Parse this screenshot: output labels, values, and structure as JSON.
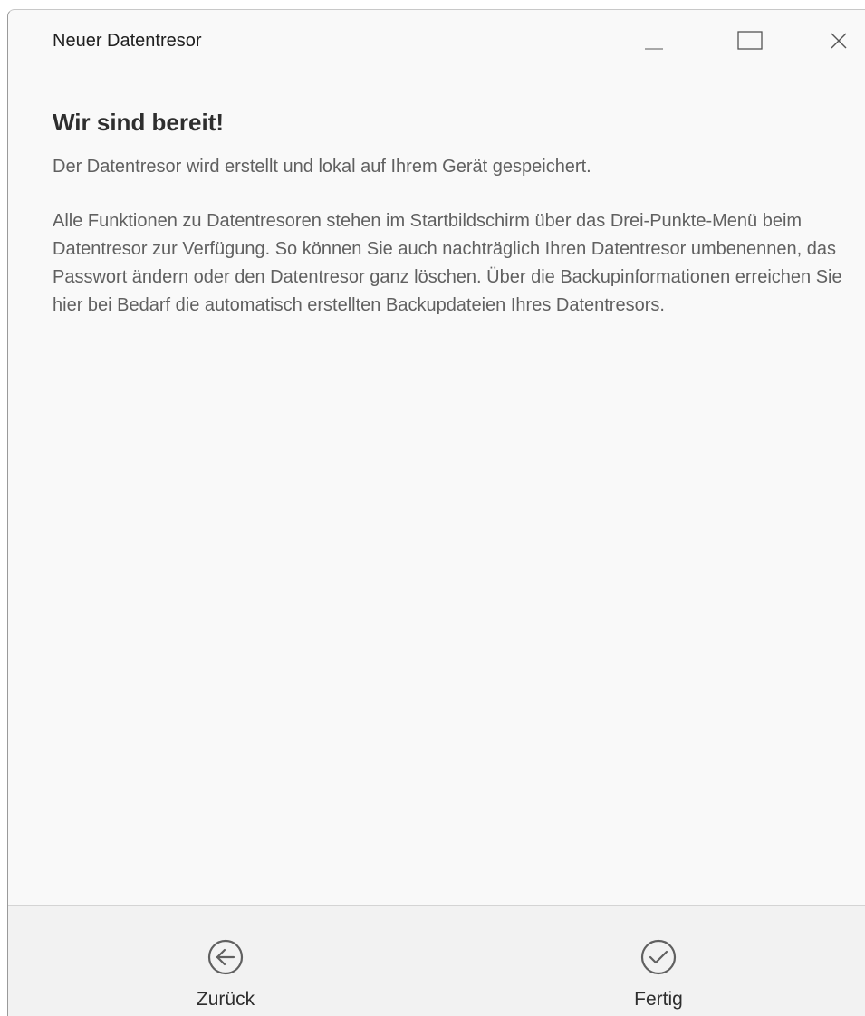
{
  "window": {
    "title": "Neuer Datentresor",
    "controls": {
      "minimize_icon": "minimize-icon",
      "maximize_icon": "maximize-icon",
      "close_icon": "close-icon"
    }
  },
  "main": {
    "heading": "Wir sind bereit!",
    "paragraphs": [
      "Der Datentresor wird erstellt und lokal auf Ihrem Gerät gespeichert.",
      "Alle Funktionen zu Datentresoren stehen im Startbildschirm über das Drei-Punkte-Menü beim Datentresor zur Verfügung. So können Sie auch nachträglich Ihren Datentresor umbenennen, das Passwort ändern oder den Datentresor ganz löschen. Über die Backupinformationen erreichen Sie hier bei Bedarf die automatisch erstellten Backupdateien Ihres Datentresors."
    ]
  },
  "footer": {
    "back": {
      "label": "Zurück",
      "icon": "arrow-left-circle-icon"
    },
    "done": {
      "label": "Fertig",
      "icon": "check-circle-icon"
    }
  },
  "colors": {
    "window_background": "#f9f9f9",
    "footer_background": "#f2f2f2",
    "icon_color": "#606060"
  }
}
